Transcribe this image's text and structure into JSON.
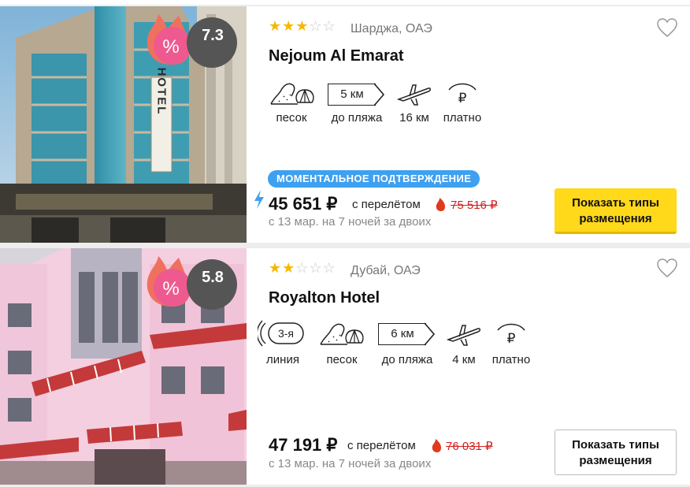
{
  "hotels": [
    {
      "stars": 3,
      "stars_filled": "★★★",
      "stars_empty": "☆☆",
      "location": "Шарджа, ОАЭ",
      "name": "Nejoum Al Emarat",
      "rating": "7.3",
      "rating_color": "#555555",
      "discount_symbol": "%",
      "features": {
        "sand": "песок",
        "beach_distance_value": "5 км",
        "beach_distance_label": "до пляжа",
        "airport_distance": "16 км",
        "wifi": "платно",
        "wifi_symbol": "₽"
      },
      "photo_sign_text": "HOTEL",
      "instant_confirmation": "МОМЕНТАЛЬНОЕ ПОДТВЕРЖДЕНИЕ",
      "price": "45 651 ₽",
      "price_suffix": "с перелётом",
      "old_price": "75 516 ₽",
      "dates": "с 13 мар. на 7 ночей за двоих",
      "button_line1": "Показать типы",
      "button_line2": "размещения"
    },
    {
      "stars": 2,
      "stars_filled": "★★",
      "stars_empty": "☆☆☆",
      "location": "Дубай, ОАЭ",
      "name": "Royalton Hotel",
      "rating": "5.8",
      "rating_color": "#555555",
      "discount_symbol": "%",
      "features": {
        "line_value": "3-я",
        "line_label": "линия",
        "sand": "песок",
        "beach_distance_value": "6 км",
        "beach_distance_label": "до пляжа",
        "airport_distance": "4 км",
        "wifi": "платно",
        "wifi_symbol": "₽"
      },
      "price": "47 191 ₽",
      "price_suffix": "с перелётом",
      "old_price": "76 031 ₽",
      "dates": "с 13 мар. на 7 ночей за двоих",
      "button_line1": "Показать типы",
      "button_line2": "размещения"
    }
  ],
  "colors": {
    "accent_yellow": "#ffd91a",
    "instant_blue": "#3ea0f0",
    "old_price_red": "#d32020",
    "star": "#f5b800"
  },
  "icons": [
    "heart-icon",
    "sand-shell-icon",
    "signpost-icon",
    "airplane-icon",
    "wifi-icon",
    "fire-icon",
    "lightning-icon",
    "beach-line-icon",
    "discount-badge-icon"
  ]
}
